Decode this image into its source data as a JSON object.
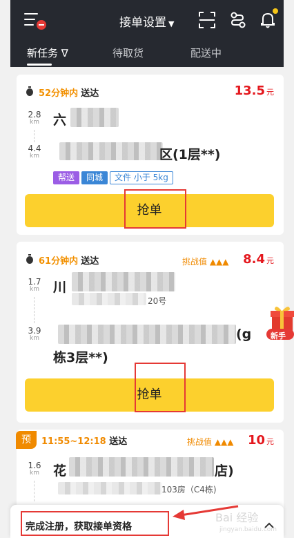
{
  "header": {
    "title": "接单设置",
    "tabs": [
      {
        "label": "新任务 ∇",
        "active": true
      },
      {
        "label": "待取货",
        "active": false
      },
      {
        "label": "配送中",
        "active": false
      }
    ]
  },
  "orders": [
    {
      "eta_minutes": "52分钟内",
      "eta_suffix": "送达",
      "price": "13.5",
      "price_unit": "元",
      "pickup": {
        "distance": "2.8",
        "unit": "km",
        "address": "六"
      },
      "dropoff": {
        "distance": "4.4",
        "unit": "km",
        "address": "区(1层**)"
      },
      "tags": [
        "帮送",
        "同城",
        "文件 小于 5kg"
      ],
      "button_label": "抢单"
    },
    {
      "eta_minutes": "61分钟内",
      "eta_suffix": "送达",
      "challenge_label": "挑战值 ▲▲▲",
      "price": "8.4",
      "price_unit": "元",
      "pickup": {
        "distance": "1.7",
        "unit": "km",
        "address": "川",
        "sub": "20号"
      },
      "dropoff": {
        "distance": "3.9",
        "unit": "km",
        "address": "(g",
        "address_line2": "栋3层**)"
      },
      "button_label": "抢单"
    },
    {
      "badge": "预",
      "time_range": "11:55~12:18",
      "eta_suffix": "送达",
      "challenge_label": "挑战值 ▲▲▲",
      "price": "10",
      "price_unit": "元",
      "pickup": {
        "distance": "1.6",
        "unit": "km",
        "address": "花",
        "address_end": "店)",
        "sub": "103房（C4栋)"
      }
    }
  ],
  "gift": {
    "label": "新手"
  },
  "bottom_panel": {
    "text": "完成注册，获取接单资格"
  },
  "watermark": {
    "text": "Bai 经验",
    "url": "jingyan.baidu.com"
  },
  "colors": {
    "accent_yellow": "#fcd02d",
    "price_red": "#e4171d",
    "eta_orange": "#f29000",
    "topbar": "#262930",
    "annotation_red": "#e53935"
  },
  "icons": [
    "menu-icon",
    "scan-icon",
    "route-icon",
    "bell-icon",
    "timer-icon",
    "gift-icon",
    "collapse-icon"
  ]
}
